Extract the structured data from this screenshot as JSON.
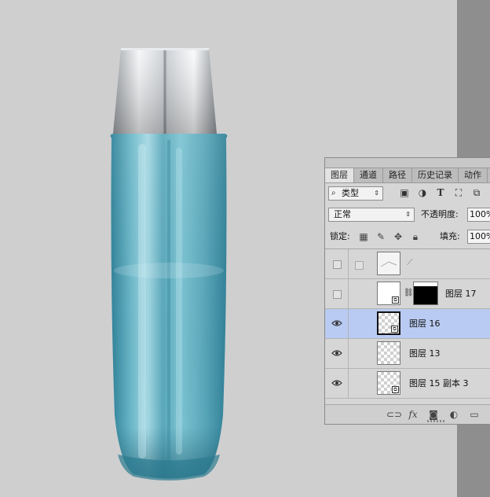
{
  "panel": {
    "tabs": [
      "图层",
      "通道",
      "路径",
      "历史记录",
      "动作"
    ],
    "filter": {
      "label": "类型",
      "icon": "search-icon"
    },
    "filter_icons": [
      "image-filter-icon",
      "adjustment-filter-icon",
      "type-filter-icon",
      "shape-filter-icon",
      "smart-object-filter-icon"
    ],
    "blend_mode": "正常",
    "opacity_label": "不透明度:",
    "opacity_value": "100%",
    "lock_label": "锁定:",
    "fill_label": "填充:",
    "fill_value": "100%",
    "footer_icons": [
      "link-layers-icon",
      "fx-icon",
      "add-mask-icon",
      "adjustment-layer-icon",
      "new-group-icon"
    ],
    "footer_fx": "fx"
  },
  "layers": [
    {
      "name": "",
      "visible": false,
      "type": "brush-stroke"
    },
    {
      "name": "图层 17",
      "visible": false,
      "type": "masked-smart-object"
    },
    {
      "name": "图层 16",
      "visible": true,
      "type": "smart-object",
      "selected": true
    },
    {
      "name": "图层 13",
      "visible": true,
      "type": "pixel"
    },
    {
      "name": "图层 15 副本 3",
      "visible": true,
      "type": "smart-object"
    }
  ],
  "colors": {
    "canvas_bg": "#cfcfd0",
    "bottle_teal": "#4fa3b8",
    "cap_silver": "#d9dde2",
    "selection": "#b9cbf2"
  }
}
